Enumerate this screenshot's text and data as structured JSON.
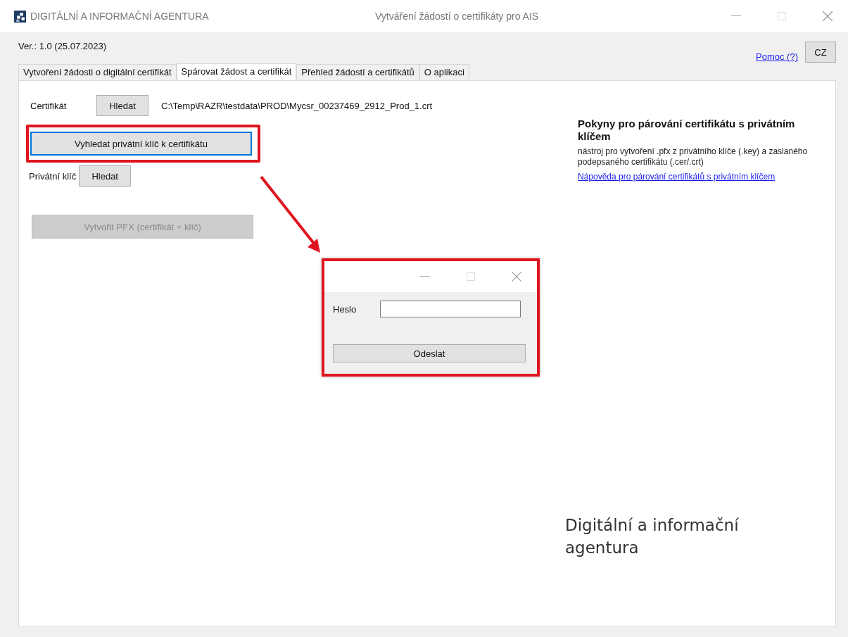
{
  "window": {
    "title": "DIGITÁLNÍ A INFORMAČNÍ AGENTURA",
    "subtitle": "Vytváření žádostí o certifikáty pro AIS"
  },
  "version": "Ver.: 1.0 (25.07.2023)",
  "help_link": "Pomoc (?)",
  "language_button": "CZ",
  "tabs": [
    {
      "label": "Vytvoření žádosti o digitální certifikát",
      "selected": false
    },
    {
      "label": "Spárovat žádost a certifikát",
      "selected": true
    },
    {
      "label": "Přehled žádostí a certifikátů",
      "selected": false
    },
    {
      "label": "O aplikaci",
      "selected": false
    }
  ],
  "certificate": {
    "label": "Certifikát",
    "button": "Hledat",
    "path": "C:\\Temp\\RAZR\\testdata\\PROD\\Mycsr_00237469_2912_Prod_1.crt"
  },
  "find_key_button": {
    "label": "Vyhledat privátní klíč k certifikátu",
    "focused": true
  },
  "private_key": {
    "label": "Privátní klíč",
    "button": "Hledat"
  },
  "create_pfx_button": {
    "label": "Vytvořit PFX (certifikát + klíč)",
    "disabled": true
  },
  "instructions": {
    "heading": "Pokyny pro párování certifikátu s privátním klíčem",
    "text": "nástroj pro vytvoření .pfx z privátního klíče (.key) a zaslaného podepsaného certifikátu (.cer/.crt)",
    "link": "Nápověda pro párování certifikátů s privátním klíčem"
  },
  "brand_text": "Digitální a informační agentura",
  "password_dialog": {
    "label": "Heslo",
    "button": "Odeslat"
  }
}
